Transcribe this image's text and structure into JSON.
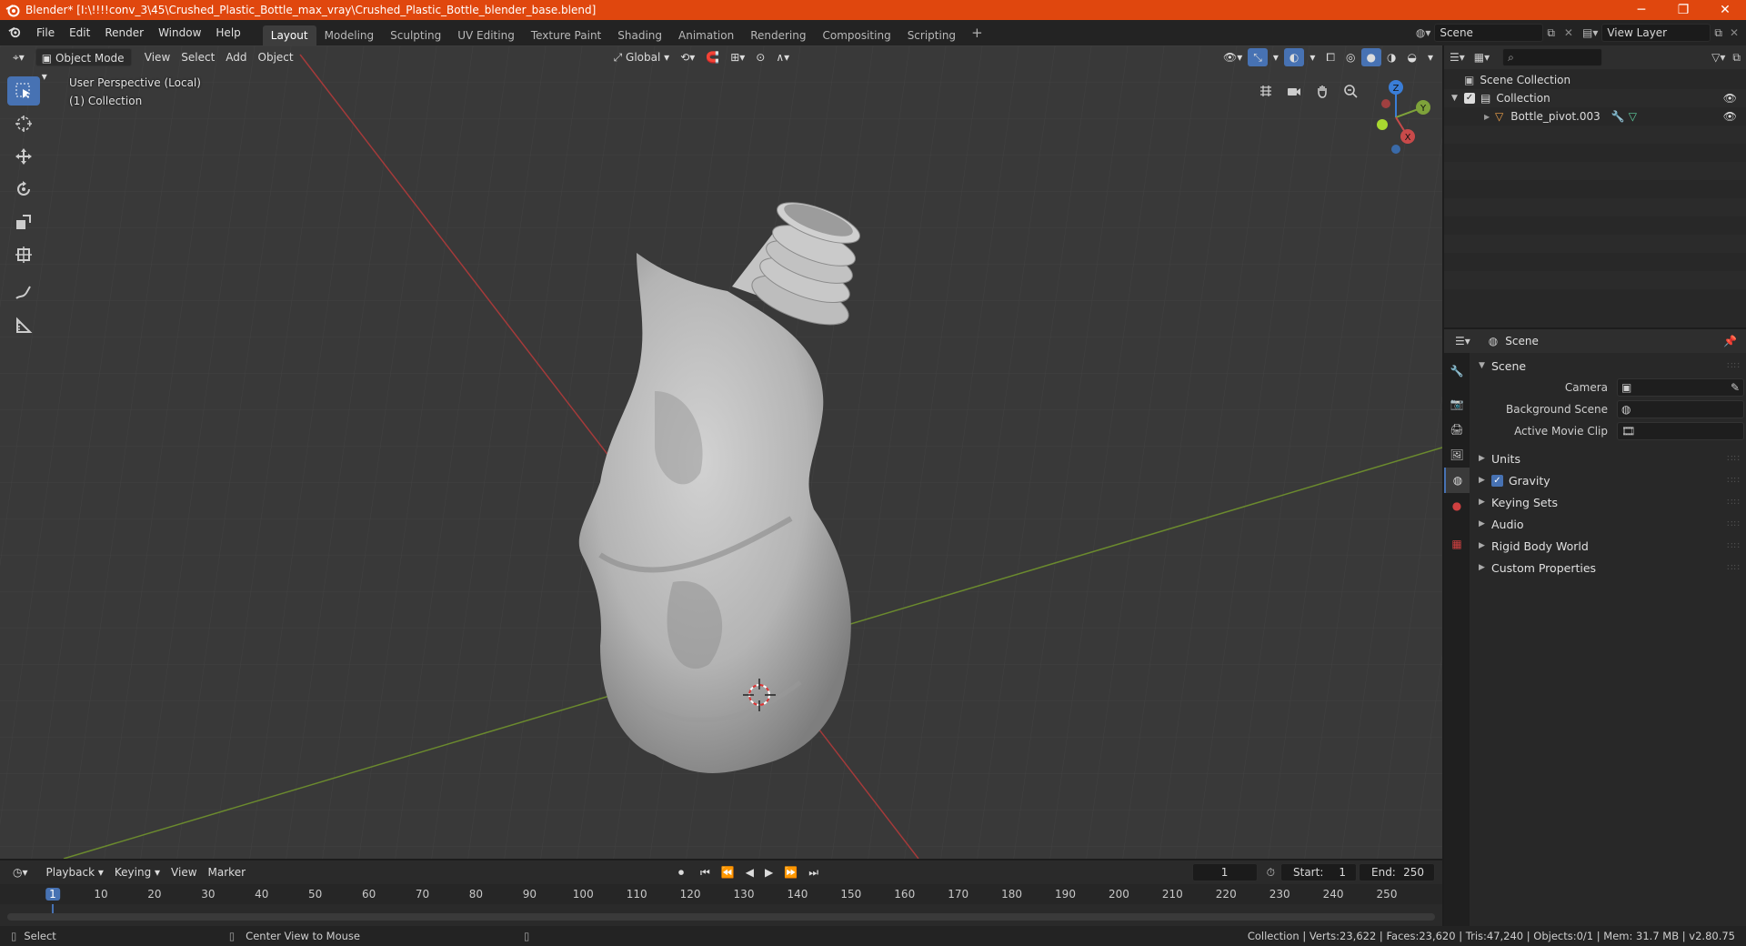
{
  "window": {
    "title": "Blender* [I:\\!!!!conv_3\\45\\Crushed_Plastic_Bottle_max_vray\\Crushed_Plastic_Bottle_blender_base.blend]",
    "minimize": "─",
    "maximize": "❐",
    "close": "✕"
  },
  "menu": [
    "File",
    "Edit",
    "Render",
    "Window",
    "Help"
  ],
  "workspaces": [
    "Layout",
    "Modeling",
    "Sculpting",
    "UV Editing",
    "Texture Paint",
    "Shading",
    "Animation",
    "Rendering",
    "Compositing",
    "Scripting"
  ],
  "workspace_add": "+",
  "scene_field": "Scene",
  "view_layer_field": "View Layer",
  "viewport": {
    "mode": "Object Mode",
    "menus": [
      "View",
      "Select",
      "Add",
      "Object"
    ],
    "orientation": "Global",
    "info_line1": "User Perspective (Local)",
    "info_line2": "(1) Collection",
    "gizmo": {
      "x": "X",
      "y": "Y",
      "z": "Z"
    }
  },
  "outliner": {
    "root": "Scene Collection",
    "collection": "Collection",
    "object": "Bottle_pivot.003"
  },
  "properties": {
    "header": "Scene",
    "panel": "Scene",
    "rows": [
      {
        "label": "Camera"
      },
      {
        "label": "Background Scene"
      },
      {
        "label": "Active Movie Clip"
      }
    ],
    "subpanels": [
      "Units",
      "Gravity",
      "Keying Sets",
      "Audio",
      "Rigid Body World",
      "Custom Properties"
    ]
  },
  "timeline": {
    "menus": [
      "Playback",
      "Keying",
      "View",
      "Marker"
    ],
    "current_frame": "1",
    "start_label": "Start:",
    "start": "1",
    "end_label": "End:",
    "end": "250",
    "ticks": [
      "1",
      "10",
      "20",
      "30",
      "40",
      "50",
      "60",
      "70",
      "80",
      "90",
      "100",
      "110",
      "120",
      "130",
      "140",
      "150",
      "160",
      "170",
      "180",
      "190",
      "200",
      "210",
      "220",
      "230",
      "240",
      "250"
    ]
  },
  "statusbar": {
    "select": "Select",
    "center_view": "Center View to Mouse",
    "stats": "Collection | Verts:23,622 | Faces:23,620 | Tris:47,240 | Objects:0/1 | Mem: 31.7 MB | v2.80.75"
  },
  "colors": {
    "titlebar": "#e0470e",
    "accent": "#4772b3",
    "x_axis": "#c84a4a",
    "y_axis": "#7ea23a",
    "z_axis": "#3a7ed8"
  }
}
